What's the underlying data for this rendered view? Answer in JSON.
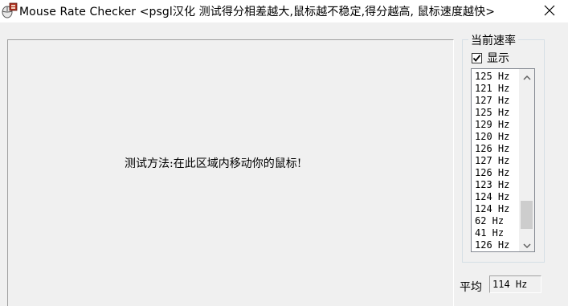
{
  "window": {
    "title": "Mouse Rate Checker <psgl汉化  测试得分相差越大,鼠标越不稳定,得分越高, 鼠标速度越快>",
    "close_icon": "close-icon",
    "app_icon": "mouse-app-icon"
  },
  "test_area": {
    "instruction": "测试方法:在此区域内移动你的鼠标!"
  },
  "rate_panel": {
    "title": "当前速率",
    "show_checkbox": {
      "label": "显示",
      "checked": true
    },
    "rates": [
      "125 Hz",
      "121 Hz",
      "127 Hz",
      "125 Hz",
      "129 Hz",
      "120 Hz",
      "126 Hz",
      "127 Hz",
      "126 Hz",
      "123 Hz",
      "124 Hz",
      "124 Hz",
      "62 Hz",
      "41 Hz",
      "126 Hz"
    ],
    "scrollbar": {
      "up_icon": "chevron-up-icon",
      "down_icon": "chevron-down-icon",
      "position": 0.93,
      "visible_fraction": 0.18
    }
  },
  "average": {
    "label": "平均",
    "value": "114 Hz"
  }
}
